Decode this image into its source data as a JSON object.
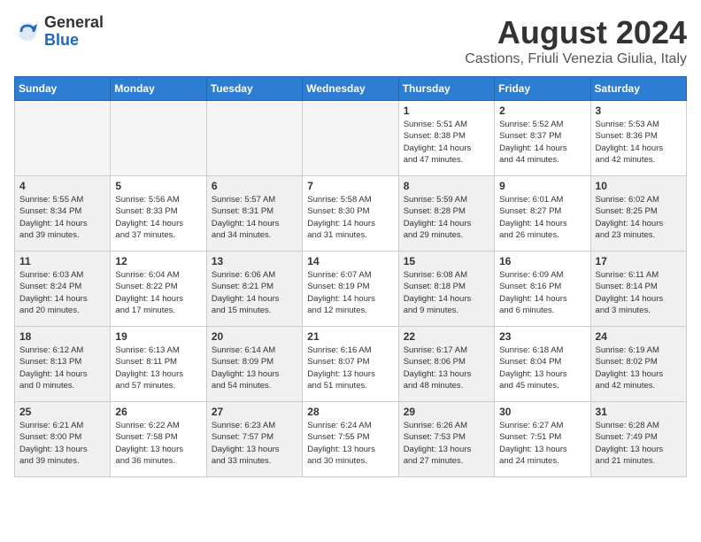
{
  "logo": {
    "general": "General",
    "blue": "Blue"
  },
  "title": {
    "month": "August 2024",
    "location": "Castions, Friuli Venezia Giulia, Italy"
  },
  "headers": [
    "Sunday",
    "Monday",
    "Tuesday",
    "Wednesday",
    "Thursday",
    "Friday",
    "Saturday"
  ],
  "weeks": [
    [
      {
        "day": "",
        "empty": true
      },
      {
        "day": "",
        "empty": true
      },
      {
        "day": "",
        "empty": true
      },
      {
        "day": "",
        "empty": true
      },
      {
        "day": "1",
        "info": "Sunrise: 5:51 AM\nSunset: 8:38 PM\nDaylight: 14 hours\nand 47 minutes."
      },
      {
        "day": "2",
        "info": "Sunrise: 5:52 AM\nSunset: 8:37 PM\nDaylight: 14 hours\nand 44 minutes."
      },
      {
        "day": "3",
        "info": "Sunrise: 5:53 AM\nSunset: 8:36 PM\nDaylight: 14 hours\nand 42 minutes."
      }
    ],
    [
      {
        "day": "4",
        "info": "Sunrise: 5:55 AM\nSunset: 8:34 PM\nDaylight: 14 hours\nand 39 minutes.",
        "shaded": true
      },
      {
        "day": "5",
        "info": "Sunrise: 5:56 AM\nSunset: 8:33 PM\nDaylight: 14 hours\nand 37 minutes."
      },
      {
        "day": "6",
        "info": "Sunrise: 5:57 AM\nSunset: 8:31 PM\nDaylight: 14 hours\nand 34 minutes.",
        "shaded": true
      },
      {
        "day": "7",
        "info": "Sunrise: 5:58 AM\nSunset: 8:30 PM\nDaylight: 14 hours\nand 31 minutes."
      },
      {
        "day": "8",
        "info": "Sunrise: 5:59 AM\nSunset: 8:28 PM\nDaylight: 14 hours\nand 29 minutes.",
        "shaded": true
      },
      {
        "day": "9",
        "info": "Sunrise: 6:01 AM\nSunset: 8:27 PM\nDaylight: 14 hours\nand 26 minutes."
      },
      {
        "day": "10",
        "info": "Sunrise: 6:02 AM\nSunset: 8:25 PM\nDaylight: 14 hours\nand 23 minutes.",
        "shaded": true
      }
    ],
    [
      {
        "day": "11",
        "info": "Sunrise: 6:03 AM\nSunset: 8:24 PM\nDaylight: 14 hours\nand 20 minutes.",
        "shaded": true
      },
      {
        "day": "12",
        "info": "Sunrise: 6:04 AM\nSunset: 8:22 PM\nDaylight: 14 hours\nand 17 minutes."
      },
      {
        "day": "13",
        "info": "Sunrise: 6:06 AM\nSunset: 8:21 PM\nDaylight: 14 hours\nand 15 minutes.",
        "shaded": true
      },
      {
        "day": "14",
        "info": "Sunrise: 6:07 AM\nSunset: 8:19 PM\nDaylight: 14 hours\nand 12 minutes."
      },
      {
        "day": "15",
        "info": "Sunrise: 6:08 AM\nSunset: 8:18 PM\nDaylight: 14 hours\nand 9 minutes.",
        "shaded": true
      },
      {
        "day": "16",
        "info": "Sunrise: 6:09 AM\nSunset: 8:16 PM\nDaylight: 14 hours\nand 6 minutes."
      },
      {
        "day": "17",
        "info": "Sunrise: 6:11 AM\nSunset: 8:14 PM\nDaylight: 14 hours\nand 3 minutes.",
        "shaded": true
      }
    ],
    [
      {
        "day": "18",
        "info": "Sunrise: 6:12 AM\nSunset: 8:13 PM\nDaylight: 14 hours\nand 0 minutes.",
        "shaded": true
      },
      {
        "day": "19",
        "info": "Sunrise: 6:13 AM\nSunset: 8:11 PM\nDaylight: 13 hours\nand 57 minutes."
      },
      {
        "day": "20",
        "info": "Sunrise: 6:14 AM\nSunset: 8:09 PM\nDaylight: 13 hours\nand 54 minutes.",
        "shaded": true
      },
      {
        "day": "21",
        "info": "Sunrise: 6:16 AM\nSunset: 8:07 PM\nDaylight: 13 hours\nand 51 minutes."
      },
      {
        "day": "22",
        "info": "Sunrise: 6:17 AM\nSunset: 8:06 PM\nDaylight: 13 hours\nand 48 minutes.",
        "shaded": true
      },
      {
        "day": "23",
        "info": "Sunrise: 6:18 AM\nSunset: 8:04 PM\nDaylight: 13 hours\nand 45 minutes."
      },
      {
        "day": "24",
        "info": "Sunrise: 6:19 AM\nSunset: 8:02 PM\nDaylight: 13 hours\nand 42 minutes.",
        "shaded": true
      }
    ],
    [
      {
        "day": "25",
        "info": "Sunrise: 6:21 AM\nSunset: 8:00 PM\nDaylight: 13 hours\nand 39 minutes.",
        "shaded": true
      },
      {
        "day": "26",
        "info": "Sunrise: 6:22 AM\nSunset: 7:58 PM\nDaylight: 13 hours\nand 36 minutes."
      },
      {
        "day": "27",
        "info": "Sunrise: 6:23 AM\nSunset: 7:57 PM\nDaylight: 13 hours\nand 33 minutes.",
        "shaded": true
      },
      {
        "day": "28",
        "info": "Sunrise: 6:24 AM\nSunset: 7:55 PM\nDaylight: 13 hours\nand 30 minutes."
      },
      {
        "day": "29",
        "info": "Sunrise: 6:26 AM\nSunset: 7:53 PM\nDaylight: 13 hours\nand 27 minutes.",
        "shaded": true
      },
      {
        "day": "30",
        "info": "Sunrise: 6:27 AM\nSunset: 7:51 PM\nDaylight: 13 hours\nand 24 minutes."
      },
      {
        "day": "31",
        "info": "Sunrise: 6:28 AM\nSunset: 7:49 PM\nDaylight: 13 hours\nand 21 minutes.",
        "shaded": true
      }
    ]
  ]
}
